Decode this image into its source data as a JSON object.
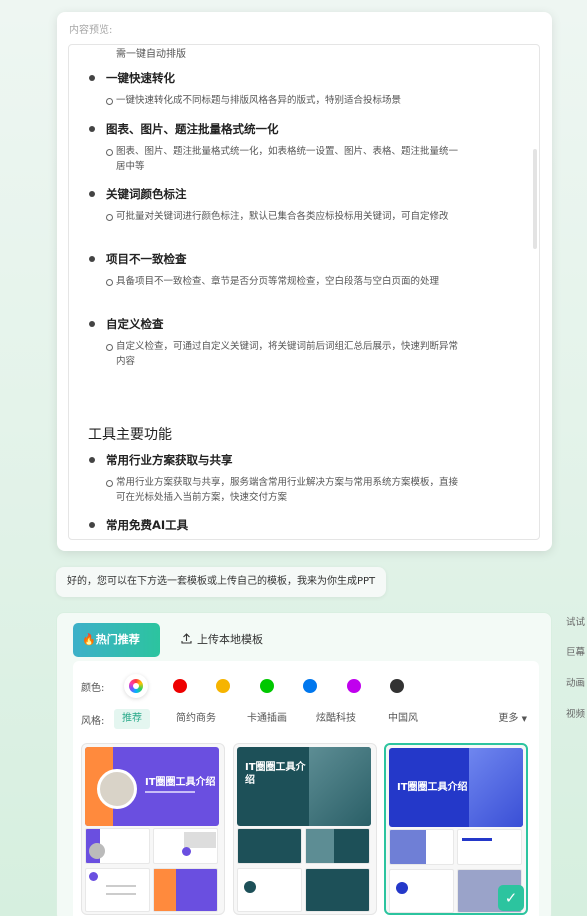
{
  "preview": {
    "label": "内容预览:",
    "top_line": "需一键自动排版",
    "items": [
      {
        "title": "一键快速转化",
        "desc": "一键快速转化成不同标题与排版风格各异的版式，特别适合投标场景"
      },
      {
        "title": "图表、图片、题注批量格式统一化",
        "desc": "图表、图片、题注批量格式统一化，如表格统一设置、图片、表格、题注批量统一居中等"
      },
      {
        "title": "关键词颜色标注",
        "desc": "可批量对关键词进行颜色标注，默认已集合各类应标投标用关键词，可自定修改"
      },
      {
        "title": "项目不一致检查",
        "desc": "具备项目不一致检查、章节是否分页等常规检查，空白段落与空白页面的处理"
      },
      {
        "title": "自定义检查",
        "desc": "自定义检查，可通过自定义关键词，将关键词前后词组汇总后展示，快速判断异常内容"
      }
    ],
    "section_heading": "工具主要功能",
    "section_items": [
      {
        "title": "常用行业方案获取与共享",
        "desc": "常用行业方案获取与共享，服务端含常用行业解决方案与常用系统方案模板，直接可在光标处插入当前方案，快速交付方案"
      },
      {
        "title": "常用免费AI工具",
        "desc": ""
      }
    ]
  },
  "reply": "好的，您可以在下方选一套模板或上传自己的模板，我来为你生成PPT",
  "template_picker": {
    "tab_hot": "热门推荐",
    "tab_upload": "上传本地模板",
    "color_label": "颜色:",
    "colors": [
      "#ee0000",
      "#f6b400",
      "#00c800",
      "#0077ee",
      "#c000ee",
      "#333333"
    ],
    "style_label": "风格:",
    "styles": [
      "推荐",
      "简约商务",
      "卡通插画",
      "炫酷科技",
      "中国风"
    ],
    "active_style": "推荐",
    "more": "更多",
    "templates": [
      {
        "title": "IT圈圈工具介绍",
        "selected": false
      },
      {
        "title": "IT圈圈工具介绍",
        "selected": false
      },
      {
        "title": "IT圈圈工具介绍",
        "selected": true
      }
    ]
  },
  "side": [
    "试试",
    "巨幕",
    "动画",
    "视频"
  ]
}
